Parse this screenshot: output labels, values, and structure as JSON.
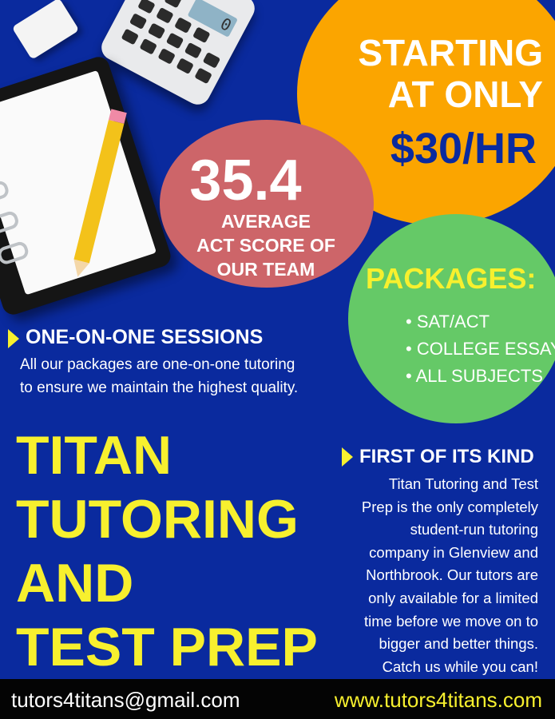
{
  "pricing": {
    "line1": "STARTING",
    "line2": "AT ONLY",
    "amount": "$30/HR"
  },
  "score": {
    "value": "35.4",
    "line1": "AVERAGE",
    "line2": "ACT SCORE OF",
    "line3": "OUR TEAM"
  },
  "packages": {
    "title": "PACKAGES:",
    "items": [
      "• SAT/ACT",
      "• COLLEGE ESSAYS",
      "• ALL SUBJECTS"
    ]
  },
  "sessions": {
    "heading": "ONE-ON-ONE SESSIONS",
    "body_line1": "All our packages are one-on-one tutoring",
    "body_line2": "to ensure we maintain the highest quality."
  },
  "title": {
    "line1": "TITAN",
    "line2": "TUTORING",
    "line3": "AND",
    "line4": "TEST PREP"
  },
  "first_of_kind": {
    "heading": "FIRST OF ITS KIND",
    "lines": [
      "Titan Tutoring and Test",
      "Prep is the only completely",
      "student-run tutoring",
      "company in Glenview and",
      "Northbrook. Our tutors are",
      "only available for a limited",
      "time before we move on to",
      "bigger and better things.",
      "Catch us while you can!"
    ]
  },
  "footer": {
    "email": "tutors4titans@gmail.com",
    "website": "www.tutors4titans.com"
  },
  "calculator_display": "0",
  "colors": {
    "background": "#0a2a9e",
    "accent_yellow": "#f7f02e",
    "orange": "#fba500",
    "red": "#cd6569",
    "green": "#65c967"
  },
  "icons": [
    "eraser-icon",
    "calculator-icon",
    "notebook-icon",
    "pencil-icon",
    "arrow-icon"
  ]
}
